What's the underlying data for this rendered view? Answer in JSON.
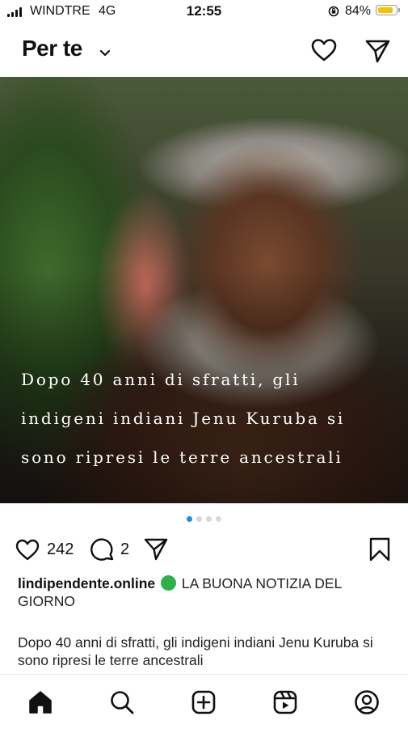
{
  "status_bar": {
    "carrier": "WINDTRE",
    "network": "4G",
    "time": "12:55",
    "battery_percent": "84%",
    "battery_level": 0.84,
    "battery_color": "#f5c400"
  },
  "header": {
    "title": "Per te",
    "icons": [
      "chevron-down-icon",
      "heart-icon",
      "send-icon"
    ]
  },
  "post": {
    "image_headline_lines": [
      "Dopo 40 anni di sfratti, gli",
      "indigeni indiani Jenu Kuruba si",
      "sono ripresi le terre ancestrali"
    ],
    "carousel": {
      "count": 4,
      "active_index": 0,
      "active_color": "#1d8cf0"
    },
    "likes": "242",
    "comments": "2",
    "caption_user": "lindipendente.online",
    "caption_emoji": "green-circle",
    "caption_text": "LA BUONA NOTIZIA DEL GIORNO",
    "body_text": "Dopo 40 anni di sfratti, gli indigeni indiani Jenu Kuruba si sono ripresi le terre ancestrali"
  },
  "bottom_nav": {
    "items": [
      "home-icon",
      "search-icon",
      "create-icon",
      "reels-icon",
      "profile-icon"
    ]
  }
}
